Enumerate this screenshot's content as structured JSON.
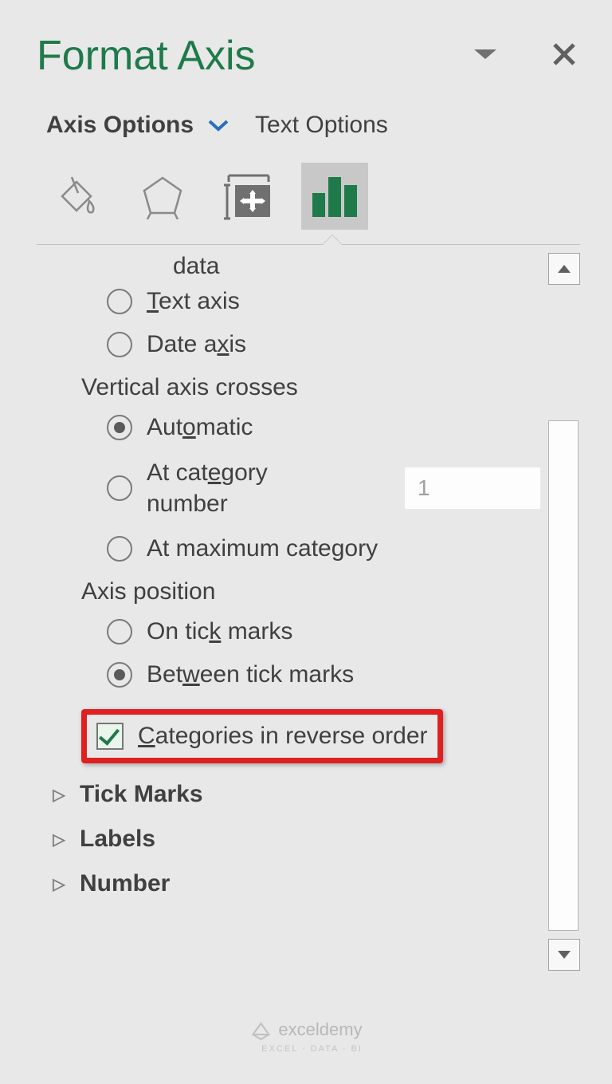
{
  "title": "Format Axis",
  "tabs": {
    "axis_options": "Axis Options",
    "text_options": "Text Options"
  },
  "truncated_top": "data",
  "axis_type": {
    "text_axis": "Text axis",
    "date_axis": "Date axis"
  },
  "vertical_crosses": {
    "heading": "Vertical axis crosses",
    "automatic": "Automatic",
    "at_category": "At category number",
    "at_max": "At maximum category",
    "category_value": "1"
  },
  "axis_position": {
    "heading": "Axis position",
    "on_tick": "On tick marks",
    "between_tick": "Between tick marks",
    "reverse": "Categories in reverse order"
  },
  "sections": {
    "tick_marks": "Tick Marks",
    "labels": "Labels",
    "number": "Number"
  },
  "watermark": {
    "brand": "exceldemy",
    "sub": "EXCEL · DATA · BI"
  }
}
